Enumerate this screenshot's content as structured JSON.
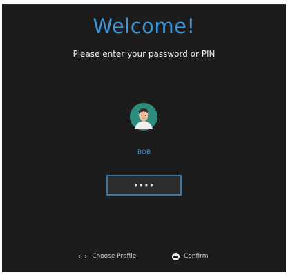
{
  "header": {
    "title": "Welcome!",
    "subtitle": "Please enter your password or PIN"
  },
  "profile": {
    "username": "BOB",
    "avatar_icon": "user-avatar-icon"
  },
  "password": {
    "value": "****"
  },
  "footer": {
    "choose_profile": {
      "icon": "left-right-arrows-icon",
      "glyph": "‹ ›",
      "label": "Choose Profile"
    },
    "confirm": {
      "icon": "button-icon",
      "label": "Confirm"
    }
  },
  "colors": {
    "background": "#1c1c1d",
    "accent": "#3d97d6",
    "field_border": "#3a78a8",
    "text": "#eeeeee"
  }
}
